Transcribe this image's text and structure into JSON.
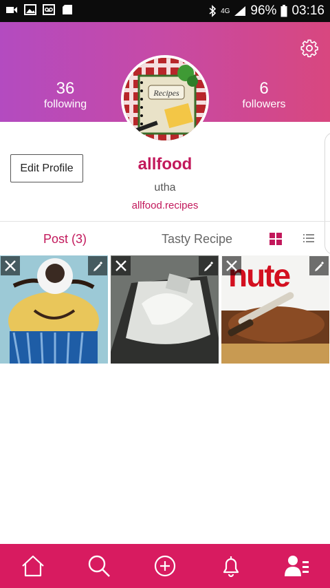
{
  "status_bar": {
    "battery": "96%",
    "time": "03:16",
    "network": "4G",
    "left_icons": [
      "video-camera-icon",
      "image-icon",
      "voicemail-icon",
      "sd-card-icon"
    ],
    "right_icons": [
      "bluetooth-icon",
      "signal-icon",
      "battery-icon"
    ]
  },
  "header": {
    "gradient": [
      "#b34bc0",
      "#d8477f"
    ],
    "following_count": "36",
    "following_label": "following",
    "followers_count": "6",
    "followers_label": "followers",
    "settings_icon": "gear-icon"
  },
  "profile": {
    "edit_button": "Edit Profile",
    "username": "allfood",
    "display_name": "utha",
    "link": "allfood.recipes",
    "avatar_text": "Recipes"
  },
  "tabs": {
    "posts": "Post (3)",
    "tasty": "Tasty Recipe",
    "active": "posts"
  },
  "photos": [
    {
      "remove_icon": "close-icon",
      "edit_icon": "pencil-icon"
    },
    {
      "remove_icon": "close-icon",
      "edit_icon": "pencil-icon"
    },
    {
      "remove_icon": "close-icon",
      "edit_icon": "pencil-icon",
      "visible_text": "nute"
    }
  ],
  "bottom_nav": {
    "color": "#d81b60",
    "items": [
      "home-icon",
      "search-icon",
      "add-icon",
      "bell-icon",
      "profile-icon"
    ]
  },
  "colors": {
    "accent": "#c2185b",
    "nav": "#d81b60"
  }
}
